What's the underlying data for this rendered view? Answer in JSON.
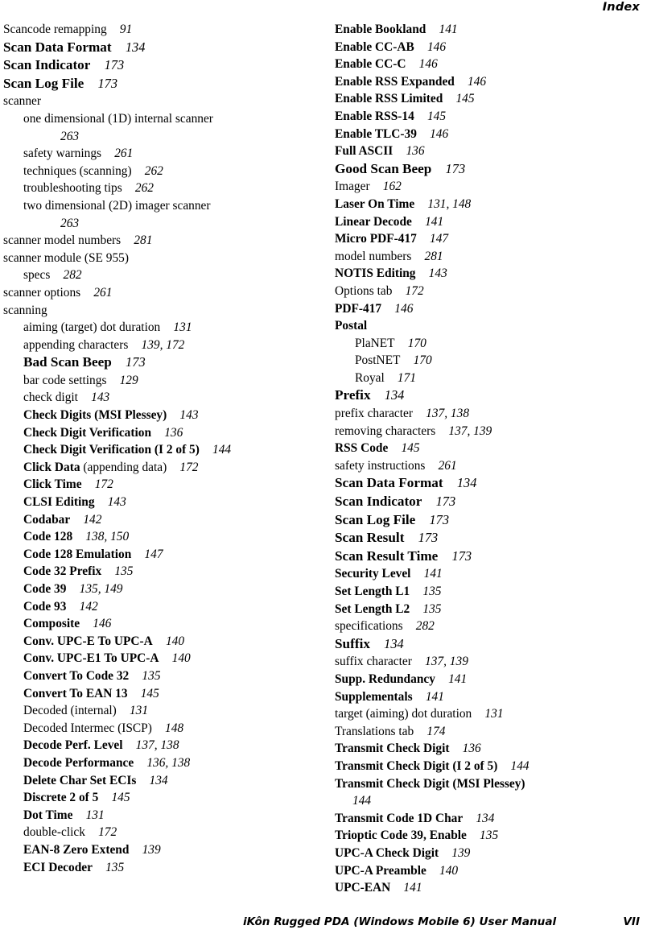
{
  "header": {
    "running_head": "Index"
  },
  "footer": {
    "title": "iKôn Rugged PDA (Windows Mobile 6) User Manual",
    "page_number": "VII"
  },
  "columns": {
    "left": [
      {
        "term": "Scancode remapping",
        "pages": "91",
        "style": "plain",
        "level": 0
      },
      {
        "term": "Scan Data Format",
        "pages": "134",
        "style": "big",
        "level": 0
      },
      {
        "term": "Scan Indicator",
        "pages": "173",
        "style": "big",
        "level": 0
      },
      {
        "term": "Scan Log File",
        "pages": "173",
        "style": "big",
        "level": 0
      },
      {
        "term": "scanner",
        "pages": "",
        "style": "plain",
        "level": 0
      },
      {
        "term": "one dimensional (1D) internal scanner",
        "pages": "263",
        "style": "plain",
        "level": 1,
        "wrap": true
      },
      {
        "term": "safety warnings",
        "pages": "261",
        "style": "plain",
        "level": 1
      },
      {
        "term": "techniques (scanning)",
        "pages": "262",
        "style": "plain",
        "level": 1
      },
      {
        "term": "troubleshooting tips",
        "pages": "262",
        "style": "plain",
        "level": 1
      },
      {
        "term": "two dimensional (2D) imager scanner",
        "pages": "263",
        "style": "plain",
        "level": 1,
        "wrap": true
      },
      {
        "term": "scanner model numbers",
        "pages": "281",
        "style": "plain",
        "level": 0
      },
      {
        "term": "scanner module (SE 955)",
        "pages": "",
        "style": "plain",
        "level": 0
      },
      {
        "term": "specs",
        "pages": "282",
        "style": "plain",
        "level": 1
      },
      {
        "term": "scanner options",
        "pages": "261",
        "style": "plain",
        "level": 0
      },
      {
        "term": "scanning",
        "pages": "",
        "style": "plain",
        "level": 0
      },
      {
        "term": "aiming (target) dot duration",
        "pages": "131",
        "style": "plain",
        "level": 1
      },
      {
        "term": "appending characters",
        "pages": "139, 172",
        "style": "plain",
        "level": 1
      },
      {
        "term": "Bad Scan Beep",
        "pages": "173",
        "style": "big",
        "level": 1
      },
      {
        "term": "bar code settings",
        "pages": "129",
        "style": "plain",
        "level": 1
      },
      {
        "term": "check digit",
        "pages": "143",
        "style": "plain",
        "level": 1
      },
      {
        "term": "Check Digits (MSI Plessey)",
        "pages": "143",
        "style": "bold",
        "level": 1
      },
      {
        "term": "Check Digit Verification",
        "pages": "136",
        "style": "bold",
        "level": 1
      },
      {
        "term": "Check Digit Verification (I 2 of 5)",
        "pages": "144",
        "style": "bold",
        "level": 1
      },
      {
        "term": "Click Data",
        "term_tail": " (appending data)",
        "pages": "172",
        "style": "bold",
        "level": 1
      },
      {
        "term": "Click Time",
        "pages": "172",
        "style": "bold",
        "level": 1
      },
      {
        "term": "CLSI Editing",
        "pages": "143",
        "style": "bold",
        "level": 1
      },
      {
        "term": "Codabar",
        "pages": "142",
        "style": "bold",
        "level": 1
      },
      {
        "term": "Code 128",
        "pages": "138, 150",
        "style": "bold",
        "level": 1
      },
      {
        "term": "Code 128 Emulation",
        "pages": "147",
        "style": "bold",
        "level": 1
      },
      {
        "term": "Code 32 Prefix",
        "pages": "135",
        "style": "bold",
        "level": 1
      },
      {
        "term": "Code 39",
        "pages": "135, 149",
        "style": "bold",
        "level": 1
      },
      {
        "term": "Code 93",
        "pages": "142",
        "style": "bold",
        "level": 1
      },
      {
        "term": "Composite",
        "pages": "146",
        "style": "bold",
        "level": 1
      },
      {
        "term": "Conv. UPC-E To UPC-A",
        "pages": "140",
        "style": "bold",
        "level": 1
      },
      {
        "term": "Conv. UPC-E1 To UPC-A",
        "pages": "140",
        "style": "bold",
        "level": 1
      },
      {
        "term": "Convert To Code 32",
        "pages": "135",
        "style": "bold",
        "level": 1
      },
      {
        "term": "Convert To EAN 13",
        "pages": "145",
        "style": "bold",
        "level": 1
      },
      {
        "term": "Decoded (internal)",
        "pages": "131",
        "style": "plain",
        "level": 1
      },
      {
        "term": "Decoded Intermec (ISCP)",
        "pages": "148",
        "style": "plain",
        "level": 1
      },
      {
        "term": "Decode Perf. Level",
        "pages": "137, 138",
        "style": "bold",
        "level": 1
      },
      {
        "term": "Decode Performance",
        "pages": "136, 138",
        "style": "bold",
        "level": 1
      },
      {
        "term": "Delete Char Set ECIs",
        "pages": "134",
        "style": "bold",
        "level": 1
      },
      {
        "term": "Discrete 2 of 5",
        "pages": "145",
        "style": "bold",
        "level": 1
      },
      {
        "term": "Dot Time",
        "pages": "131",
        "style": "bold",
        "level": 1
      },
      {
        "term": "double-click",
        "pages": "172",
        "style": "plain",
        "level": 1
      },
      {
        "term": "EAN-8 Zero Extend",
        "pages": "139",
        "style": "bold",
        "level": 1
      },
      {
        "term": "ECI Decoder",
        "pages": "135",
        "style": "bold",
        "level": 1
      }
    ],
    "right": [
      {
        "term": "Enable Bookland",
        "pages": "141",
        "style": "bold",
        "level": 0
      },
      {
        "term": "Enable CC-AB",
        "pages": "146",
        "style": "bold",
        "level": 0
      },
      {
        "term": "Enable CC-C",
        "pages": "146",
        "style": "bold",
        "level": 0
      },
      {
        "term": "Enable RSS Expanded",
        "pages": "146",
        "style": "bold",
        "level": 0
      },
      {
        "term": "Enable RSS Limited",
        "pages": "145",
        "style": "bold",
        "level": 0
      },
      {
        "term": "Enable RSS-14",
        "pages": "145",
        "style": "bold",
        "level": 0
      },
      {
        "term": "Enable TLC-39",
        "pages": "146",
        "style": "bold",
        "level": 0
      },
      {
        "term": "Full ASCII",
        "pages": "136",
        "style": "bold",
        "level": 0
      },
      {
        "term": "Good Scan Beep",
        "pages": "173",
        "style": "big",
        "level": 0
      },
      {
        "term": "Imager",
        "pages": "162",
        "style": "plain",
        "level": 0
      },
      {
        "term": "Laser On Time",
        "pages": "131, 148",
        "style": "bold",
        "level": 0
      },
      {
        "term": "Linear Decode",
        "pages": "141",
        "style": "bold",
        "level": 0
      },
      {
        "term": "Micro PDF-417",
        "pages": "147",
        "style": "bold",
        "level": 0
      },
      {
        "term": "model numbers",
        "pages": "281",
        "style": "plain",
        "level": 0
      },
      {
        "term": "NOTIS Editing",
        "pages": "143",
        "style": "bold",
        "level": 0
      },
      {
        "term": "Options tab",
        "pages": "172",
        "style": "plain",
        "level": 0
      },
      {
        "term": "PDF-417",
        "pages": "146",
        "style": "bold",
        "level": 0
      },
      {
        "term": "Postal",
        "pages": "",
        "style": "bold",
        "level": 0
      },
      {
        "term": "PlaNET",
        "pages": "170",
        "style": "plain",
        "level": 1
      },
      {
        "term": "PostNET",
        "pages": "170",
        "style": "plain",
        "level": 1
      },
      {
        "term": "Royal",
        "pages": "171",
        "style": "plain",
        "level": 1
      },
      {
        "term": "Prefix",
        "pages": "134",
        "style": "big",
        "level": 0
      },
      {
        "term": "prefix character",
        "pages": "137, 138",
        "style": "plain",
        "level": 0
      },
      {
        "term": "removing characters",
        "pages": "137, 139",
        "style": "plain",
        "level": 0
      },
      {
        "term": "RSS Code",
        "pages": "145",
        "style": "bold",
        "level": 0
      },
      {
        "term": "safety instructions",
        "pages": "261",
        "style": "plain",
        "level": 0
      },
      {
        "term": "Scan Data Format",
        "pages": "134",
        "style": "big",
        "level": 0
      },
      {
        "term": "Scan Indicator",
        "pages": "173",
        "style": "big",
        "level": 0
      },
      {
        "term": "Scan Log File",
        "pages": "173",
        "style": "big",
        "level": 0
      },
      {
        "term": "Scan Result",
        "pages": "173",
        "style": "big",
        "level": 0
      },
      {
        "term": "Scan Result Time",
        "pages": "173",
        "style": "big",
        "level": 0
      },
      {
        "term": "Security Level",
        "pages": "141",
        "style": "bold",
        "level": 0
      },
      {
        "term": "Set Length L1",
        "pages": "135",
        "style": "bold",
        "level": 0
      },
      {
        "term": "Set Length L2",
        "pages": "135",
        "style": "bold",
        "level": 0
      },
      {
        "term": "specifications",
        "pages": "282",
        "style": "plain",
        "level": 0
      },
      {
        "term": "Suffix",
        "pages": "134",
        "style": "big",
        "level": 0
      },
      {
        "term": "suffix character",
        "pages": "137, 139",
        "style": "plain",
        "level": 0
      },
      {
        "term": "Supp. Redundancy",
        "pages": "141",
        "style": "bold",
        "level": 0
      },
      {
        "term": "Supplementals",
        "pages": "141",
        "style": "bold",
        "level": 0
      },
      {
        "term": "target (aiming) dot duration",
        "pages": "131",
        "style": "plain",
        "level": 0
      },
      {
        "term": "Translations tab",
        "pages": "174",
        "style": "plain",
        "level": 0
      },
      {
        "term": "Transmit Check Digit",
        "pages": "136",
        "style": "bold",
        "level": 0
      },
      {
        "term": "Transmit Check Digit (I 2 of 5)",
        "pages": "144",
        "style": "bold",
        "level": 0
      },
      {
        "term": "Transmit Check Digit (MSI Plessey)",
        "pages": "144",
        "style": "bold",
        "level": 0,
        "wrap": true
      },
      {
        "term": "Transmit Code 1D Char",
        "pages": "134",
        "style": "bold",
        "level": 0
      },
      {
        "term": "Trioptic Code 39, Enable",
        "pages": "135",
        "style": "bold",
        "level": 0
      },
      {
        "term": "UPC-A Check Digit",
        "pages": "139",
        "style": "bold",
        "level": 0
      },
      {
        "term": "UPC-A Preamble",
        "pages": "140",
        "style": "bold",
        "level": 0
      },
      {
        "term": "UPC-EAN",
        "pages": "141",
        "style": "bold",
        "level": 0
      }
    ]
  }
}
